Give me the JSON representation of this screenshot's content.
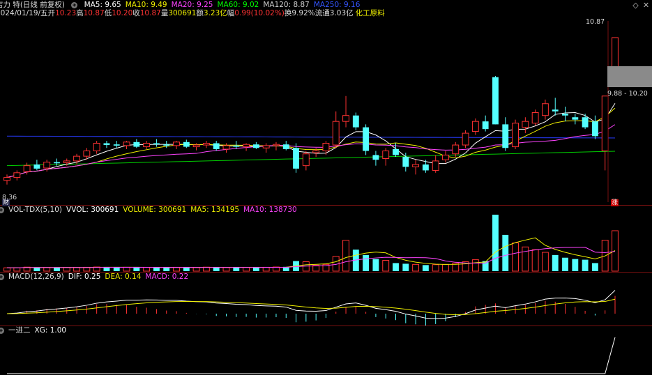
{
  "stock": {
    "name_partial": "吉力 特(日线 前复权)",
    "ma": [
      {
        "label": "MA5:",
        "value": "9.65",
        "color": "#ffffff"
      },
      {
        "label": "MA10:",
        "value": "9.49",
        "color": "#f0f000"
      },
      {
        "label": "MA20:",
        "value": "9.25",
        "color": "#ff44ff"
      },
      {
        "label": "MA60:",
        "value": "9.02",
        "color": "#00ff00"
      },
      {
        "label": "MA120:",
        "value": "8.87",
        "color": "#cccccc"
      },
      {
        "label": "MA250:",
        "value": "9.16",
        "color": "#3355ff"
      }
    ]
  },
  "info": {
    "date": "2024/01/19/五",
    "open_label": "开",
    "open": "10.23",
    "high_label": "高",
    "high": "10.87",
    "low_label": "低",
    "low": "10.20",
    "close_label": "收",
    "close": "10.87",
    "volume_label": "量",
    "volume": "300691",
    "amount_label": "额",
    "amount": "3.23亿",
    "change_label": "幅",
    "change": "0.99(10.02%)",
    "turnover_label": "换",
    "turnover": "9.92%",
    "float_label": "流通",
    "float": "3.03亿",
    "sector": "化工原料"
  },
  "price_axis": {
    "high_marker": "10.87",
    "low_marker": "8.36",
    "range_box": "9.88 - 10.20"
  },
  "badges": {
    "fin": "财",
    "limit_up": "涨"
  },
  "volume_panel": {
    "title": "VOL-TDX(5,10)",
    "items": [
      {
        "label": "VVOL:",
        "value": "300691",
        "color": "#ffffff"
      },
      {
        "label": "VOLUME:",
        "value": "300691",
        "color": "#f0f000"
      },
      {
        "label": "MA5:",
        "value": "134195",
        "color": "#f0f000"
      },
      {
        "label": "MA10:",
        "value": "138730",
        "color": "#ff44ff"
      }
    ]
  },
  "macd_panel": {
    "title": "MACD(12,26,9)",
    "items": [
      {
        "label": "DIF:",
        "value": "0.25",
        "color": "#ffffff"
      },
      {
        "label": "DEA:",
        "value": "0.14",
        "color": "#f0f000"
      },
      {
        "label": "MACD:",
        "value": "0.22",
        "color": "#ff44ff"
      }
    ]
  },
  "xg_panel": {
    "title": "一进二",
    "items": [
      {
        "label": "XG:",
        "value": "1.00",
        "color": "#ffffff"
      }
    ]
  },
  "chart_data": {
    "type": "candlestick",
    "ylim": [
      8.2,
      11.2
    ],
    "candles": [
      {
        "o": 8.45,
        "h": 8.55,
        "l": 8.38,
        "c": 8.5
      },
      {
        "o": 8.5,
        "h": 8.62,
        "l": 8.45,
        "c": 8.58
      },
      {
        "o": 8.6,
        "h": 8.75,
        "l": 8.55,
        "c": 8.7
      },
      {
        "o": 8.72,
        "h": 8.8,
        "l": 8.62,
        "c": 8.65
      },
      {
        "o": 8.66,
        "h": 8.8,
        "l": 8.6,
        "c": 8.76
      },
      {
        "o": 8.76,
        "h": 8.82,
        "l": 8.7,
        "c": 8.74
      },
      {
        "o": 8.75,
        "h": 8.82,
        "l": 8.7,
        "c": 8.78
      },
      {
        "o": 8.78,
        "h": 8.9,
        "l": 8.72,
        "c": 8.86
      },
      {
        "o": 8.86,
        "h": 9.0,
        "l": 8.8,
        "c": 8.95
      },
      {
        "o": 8.95,
        "h": 9.12,
        "l": 8.9,
        "c": 9.08
      },
      {
        "o": 9.08,
        "h": 9.12,
        "l": 9.0,
        "c": 9.05
      },
      {
        "o": 9.06,
        "h": 9.12,
        "l": 9.0,
        "c": 9.04
      },
      {
        "o": 9.04,
        "h": 9.12,
        "l": 8.98,
        "c": 9.1
      },
      {
        "o": 9.1,
        "h": 9.15,
        "l": 9.0,
        "c": 9.02
      },
      {
        "o": 9.02,
        "h": 9.12,
        "l": 8.98,
        "c": 9.08
      },
      {
        "o": 9.08,
        "h": 9.15,
        "l": 9.02,
        "c": 9.06
      },
      {
        "o": 9.06,
        "h": 9.12,
        "l": 9.0,
        "c": 9.04
      },
      {
        "o": 9.04,
        "h": 9.12,
        "l": 8.98,
        "c": 9.1
      },
      {
        "o": 9.1,
        "h": 9.14,
        "l": 9.0,
        "c": 9.02
      },
      {
        "o": 9.02,
        "h": 9.08,
        "l": 8.96,
        "c": 9.05
      },
      {
        "o": 9.05,
        "h": 9.12,
        "l": 9.0,
        "c": 9.08
      },
      {
        "o": 9.08,
        "h": 9.12,
        "l": 8.95,
        "c": 8.98
      },
      {
        "o": 8.98,
        "h": 9.08,
        "l": 8.92,
        "c": 9.04
      },
      {
        "o": 9.04,
        "h": 9.12,
        "l": 8.98,
        "c": 9.02
      },
      {
        "o": 9.02,
        "h": 9.08,
        "l": 8.95,
        "c": 9.06
      },
      {
        "o": 9.06,
        "h": 9.1,
        "l": 8.98,
        "c": 9.0
      },
      {
        "o": 9.0,
        "h": 9.08,
        "l": 8.92,
        "c": 9.04
      },
      {
        "o": 9.04,
        "h": 9.1,
        "l": 8.96,
        "c": 9.06
      },
      {
        "o": 9.06,
        "h": 9.12,
        "l": 8.96,
        "c": 8.98
      },
      {
        "o": 9.0,
        "h": 9.08,
        "l": 8.58,
        "c": 8.65
      },
      {
        "o": 8.7,
        "h": 8.95,
        "l": 8.62,
        "c": 8.9
      },
      {
        "o": 8.92,
        "h": 9.0,
        "l": 8.85,
        "c": 8.95
      },
      {
        "o": 8.95,
        "h": 9.12,
        "l": 8.88,
        "c": 9.08
      },
      {
        "o": 9.05,
        "h": 9.62,
        "l": 9.0,
        "c": 9.45
      },
      {
        "o": 9.45,
        "h": 9.88,
        "l": 9.35,
        "c": 9.55
      },
      {
        "o": 9.55,
        "h": 9.6,
        "l": 9.3,
        "c": 9.35
      },
      {
        "o": 9.35,
        "h": 9.4,
        "l": 8.88,
        "c": 8.95
      },
      {
        "o": 8.88,
        "h": 8.95,
        "l": 8.7,
        "c": 8.8
      },
      {
        "o": 8.82,
        "h": 9.0,
        "l": 8.7,
        "c": 8.95
      },
      {
        "o": 8.98,
        "h": 9.08,
        "l": 8.85,
        "c": 8.88
      },
      {
        "o": 8.85,
        "h": 8.92,
        "l": 8.6,
        "c": 8.68
      },
      {
        "o": 8.68,
        "h": 8.8,
        "l": 8.55,
        "c": 8.72
      },
      {
        "o": 8.72,
        "h": 8.8,
        "l": 8.58,
        "c": 8.62
      },
      {
        "o": 8.62,
        "h": 8.88,
        "l": 8.58,
        "c": 8.78
      },
      {
        "o": 8.8,
        "h": 8.95,
        "l": 8.75,
        "c": 8.88
      },
      {
        "o": 8.9,
        "h": 9.1,
        "l": 8.85,
        "c": 9.05
      },
      {
        "o": 9.05,
        "h": 9.3,
        "l": 9.0,
        "c": 9.25
      },
      {
        "o": 9.28,
        "h": 9.5,
        "l": 9.22,
        "c": 9.45
      },
      {
        "o": 9.45,
        "h": 9.55,
        "l": 9.28,
        "c": 9.32
      },
      {
        "o": 10.2,
        "h": 10.22,
        "l": 9.4,
        "c": 9.4
      },
      {
        "o": 9.4,
        "h": 9.52,
        "l": 8.95,
        "c": 9.0
      },
      {
        "o": 9.02,
        "h": 9.48,
        "l": 8.98,
        "c": 9.42
      },
      {
        "o": 9.35,
        "h": 9.52,
        "l": 9.25,
        "c": 9.45
      },
      {
        "o": 9.42,
        "h": 9.65,
        "l": 9.38,
        "c": 9.6
      },
      {
        "o": 9.55,
        "h": 9.82,
        "l": 9.48,
        "c": 9.75
      },
      {
        "o": 9.65,
        "h": 9.85,
        "l": 9.55,
        "c": 9.62
      },
      {
        "o": 9.58,
        "h": 9.7,
        "l": 9.45,
        "c": 9.55
      },
      {
        "o": 9.52,
        "h": 9.58,
        "l": 9.4,
        "c": 9.48
      },
      {
        "o": 9.52,
        "h": 9.58,
        "l": 9.32,
        "c": 9.35
      },
      {
        "o": 9.45,
        "h": 9.55,
        "l": 9.15,
        "c": 9.2
      },
      {
        "o": 8.95,
        "h": 9.88,
        "l": 8.62,
        "c": 9.88
      },
      {
        "o": 10.23,
        "h": 10.87,
        "l": 10.2,
        "c": 10.87
      }
    ],
    "volume": [
      25000,
      26000,
      30000,
      28000,
      27000,
      26000,
      27000,
      28000,
      29000,
      31000,
      30000,
      28000,
      29000,
      27000,
      28000,
      26000,
      27000,
      29000,
      28000,
      27000,
      30000,
      28000,
      27000,
      29000,
      28000,
      27000,
      29000,
      31000,
      32000,
      75000,
      70000,
      45000,
      50000,
      110000,
      230000,
      160000,
      120000,
      90000,
      80000,
      60000,
      55000,
      50000,
      45000,
      48000,
      50000,
      60000,
      70000,
      85000,
      75000,
      420000,
      270000,
      210000,
      180000,
      160000,
      140000,
      120000,
      100000,
      90000,
      85000,
      60000,
      230000,
      300691
    ],
    "xg": [
      0,
      0,
      0,
      0,
      0,
      0,
      0,
      0,
      0,
      0,
      0,
      0,
      0,
      0,
      0,
      0,
      0,
      0,
      0,
      0,
      0,
      0,
      0,
      0,
      0,
      0,
      0,
      0,
      0,
      0,
      0,
      0,
      0,
      0,
      0,
      0,
      0,
      0,
      0,
      0,
      0,
      0,
      0,
      0,
      0,
      0,
      0,
      0,
      0,
      0,
      0,
      0,
      0,
      0,
      0,
      0,
      0,
      0,
      0,
      0,
      0,
      1
    ]
  }
}
